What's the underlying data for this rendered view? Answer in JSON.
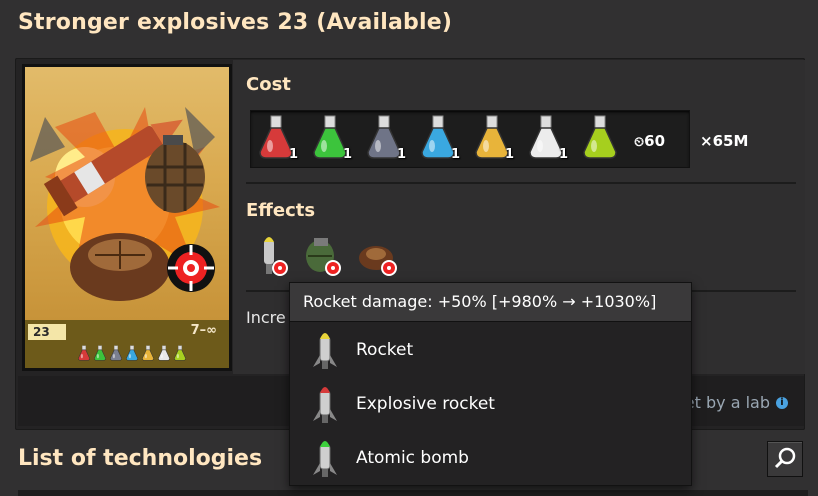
{
  "header": {
    "title": "Stronger explosives 23 (Available)"
  },
  "card": {
    "level": "23",
    "range": "7–∞",
    "flask_colors": [
      "#d63a3a",
      "#3cc43c",
      "#7a7f90",
      "#3aa8e0",
      "#e8b43a",
      "#e8e8e8",
      "#a8d020"
    ]
  },
  "cost": {
    "heading": "Cost",
    "packs": [
      {
        "color": "#d63a3a",
        "count": "1"
      },
      {
        "color": "#3cc43c",
        "count": "1"
      },
      {
        "color": "#6f7487",
        "count": "1"
      },
      {
        "color": "#3aa8e0",
        "count": "1"
      },
      {
        "color": "#e8b43a",
        "count": "1"
      },
      {
        "color": "#ececec",
        "count": "1"
      },
      {
        "color": "#a6cf1e",
        "count": ""
      }
    ],
    "time": "60",
    "multiplier": "×65M"
  },
  "effects": {
    "heading": "Effects",
    "description_visible": "Incre"
  },
  "status": {
    "lab_note": "Research is being set by a lab",
    "info": "i"
  },
  "list": {
    "title": "List of technologies"
  },
  "tooltip": {
    "header": "Rocket damage: +50% [+980% → +1030%]",
    "items": [
      {
        "label": "Rocket",
        "tip_color": "#e8d43a"
      },
      {
        "label": "Explosive rocket",
        "tip_color": "#d63a3a"
      },
      {
        "label": "Atomic bomb",
        "tip_color": "#3ccf3c"
      }
    ]
  }
}
